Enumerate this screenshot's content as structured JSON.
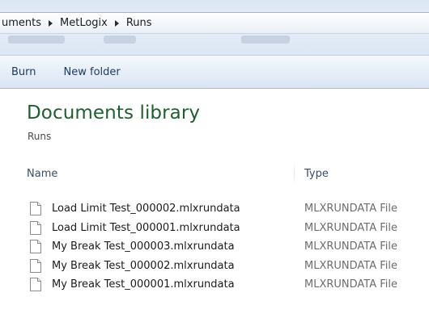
{
  "breadcrumb": {
    "items": [
      "uments",
      "MetLogix",
      "Runs"
    ]
  },
  "toolbar": {
    "burn_label": "Burn",
    "new_folder_label": "New folder"
  },
  "library": {
    "title": "Documents library",
    "subtitle": "Runs"
  },
  "columns": {
    "name": "Name",
    "type": "Type"
  },
  "files": [
    {
      "name": "Load Limit Test_000002.mlxrundata",
      "type": "MLXRUNDATA File"
    },
    {
      "name": "Load Limit Test_000001.mlxrundata",
      "type": "MLXRUNDATA File"
    },
    {
      "name": "My Break Test_000003.mlxrundata",
      "type": "MLXRUNDATA File"
    },
    {
      "name": "My Break Test_000002.mlxrundata",
      "type": "MLXRUNDATA File"
    },
    {
      "name": "My Break Test_000001.mlxrundata",
      "type": "MLXRUNDATA File"
    }
  ],
  "icons": {
    "breadcrumb_separator": "chevron-right-icon",
    "file": "document-icon"
  },
  "colors": {
    "library_title": "#1e5f2f",
    "toolbar_text": "#1e395b",
    "header_band": "#dce7f4"
  }
}
